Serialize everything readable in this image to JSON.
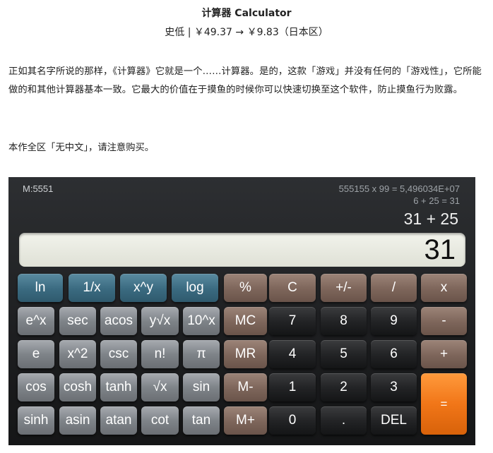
{
  "header": {
    "title": "计算器 Calculator",
    "price": "史低 | ￥49.37 → ￥9.83（日本区）"
  },
  "body": {
    "description": "正如其名字所说的那样，《计算器》它就是一个……计算器。是的，这款「游戏」并没有任何的「游戏性」，它所能做的和其他计算器基本一致。它最大的价值在于摸鱼的时候你可以快速切换至这个软件，防止摸鱼行为败露。",
    "note": "本作全区「无中文」，请注意购买。"
  },
  "calculator": {
    "memory": "M:5551",
    "history": [
      "555155 x 99 = 5,496034E+07",
      "6 + 25 = 31"
    ],
    "expression": "31 + 25",
    "display": "31",
    "keys": {
      "ln": "ln",
      "recip": "1/x",
      "pow": "x^y",
      "log": "log",
      "percent": "%",
      "clear": "C",
      "sign": "+/-",
      "divide": "/",
      "multiply": "x",
      "exp": "e^x",
      "sec": "sec",
      "acos": "acos",
      "yroot": "y√x",
      "pow10": "10^x",
      "mc": "MC",
      "seven": "7",
      "eight": "8",
      "nine": "9",
      "minus": "-",
      "e": "e",
      "square": "x^2",
      "csc": "csc",
      "fact": "n!",
      "pi": "π",
      "mr": "MR",
      "four": "4",
      "five": "5",
      "six": "6",
      "plus": "+",
      "cos": "cos",
      "cosh": "cosh",
      "tanh": "tanh",
      "sqrt": "√x",
      "sin": "sin",
      "mminus": "M-",
      "one": "1",
      "two": "2",
      "three": "3",
      "equals": "=",
      "sinh": "sinh",
      "asin": "asin",
      "atan": "atan",
      "cot": "cot",
      "tan": "tan",
      "mplus": "M+",
      "zero": "0",
      "dot": ".",
      "del": "DEL"
    },
    "colors": {
      "teal": "#3a6a80",
      "gray": "#7f8489",
      "brown": "#7d655a",
      "black": "#232426",
      "orange": "#f17618"
    }
  }
}
